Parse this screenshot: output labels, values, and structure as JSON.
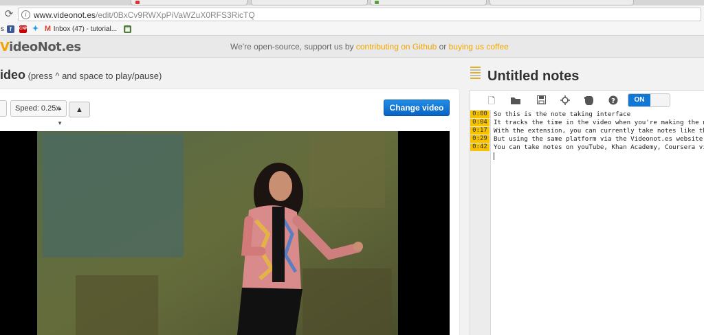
{
  "browser": {
    "url_host": "www.videonot.es",
    "url_path": "/edit/0BxCv9RWXpPiVaWZuX0RFS3RicTQ",
    "bookmarks": [
      {
        "icon": "facebook-icon",
        "label": "",
        "color": "#3b5998"
      },
      {
        "icon": "cnn-icon",
        "label": "",
        "color": "#cc0000"
      },
      {
        "icon": "twitter-icon",
        "label": "",
        "color": "#1da1f2"
      },
      {
        "icon": "gmail-icon",
        "label": "Inbox (47) - tutorial...",
        "color": "#d44638"
      },
      {
        "icon": "bookmark-app-icon",
        "label": "",
        "color": "#4f7a3a"
      }
    ]
  },
  "header": {
    "logo_v": "V",
    "logo_rest": "ideoNot.es",
    "banner_prefix": "We're open-source, support us by ",
    "banner_link1": "contributing on Github",
    "banner_mid": " or ",
    "banner_link2": "buying us coffee"
  },
  "video": {
    "title": "ideo",
    "hint": " (press ^ and space to play/pause)",
    "speed_label": "Speed: 0.25x",
    "speed_arrows": "▲▼",
    "up_label": "▲",
    "change_button": "Change video"
  },
  "notes": {
    "title": "Untitled notes",
    "toggle_label": "ON",
    "toolbar": [
      "new-file-icon",
      "open-folder-icon",
      "save-icon",
      "sync-icon",
      "evernote-icon",
      "help-icon"
    ],
    "lines": [
      {
        "time": "0:00",
        "text": "So this is the note taking interface"
      },
      {
        "time": "0:04",
        "text": "It tracks the time in the video when you're making the n"
      },
      {
        "time": "0:17",
        "text": "With the extension, you can currently take notes like th"
      },
      {
        "time": "0:29",
        "text": "But using the same platform via the Videonot.es website"
      },
      {
        "time": "0:42",
        "text": "You can take notes on youTube, Khan Academy, Coursera vi"
      }
    ]
  },
  "colors": {
    "accent": "#f2a500",
    "button_blue": "#0b63c4",
    "stamp_yellow": "#f7c200"
  }
}
